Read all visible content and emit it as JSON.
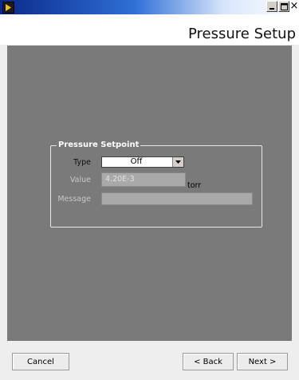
{
  "window": {
    "title": "",
    "controls": [
      "minimize-icon",
      "maximize-icon",
      "close-icon"
    ],
    "close_glyph": "×"
  },
  "header": {
    "page_title": "Pressure Setup"
  },
  "setpoint": {
    "group_title": "Pressure Setpoint",
    "type_label": "Type",
    "type_value": "Off",
    "value_label": "Value",
    "value_value": "4.20E-3",
    "unit": "torr",
    "message_label": "Message",
    "message_value": ""
  },
  "footer": {
    "cancel_label": "Cancel",
    "back_label": "< Back",
    "next_label": "Next >"
  },
  "colors": {
    "panel": "#7a7a7a",
    "title_bar_start": "#0a2a8a",
    "disabled_field": "#a9a9a9"
  }
}
